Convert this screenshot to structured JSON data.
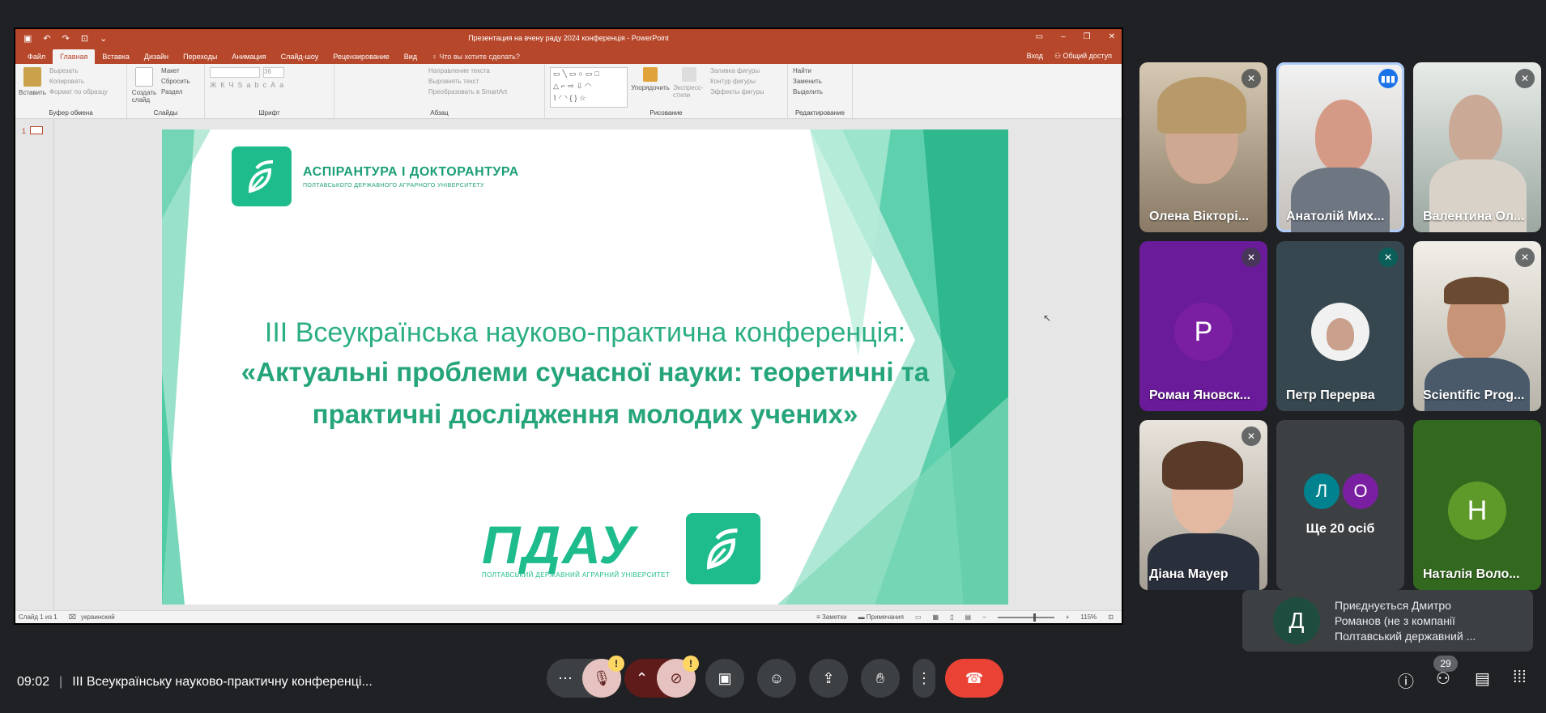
{
  "powerpoint": {
    "window_title": "Презентация на вчену раду 2024 конференція - PowerPoint",
    "tabs": [
      "Файл",
      "Главная",
      "Вставка",
      "Дизайн",
      "Переходы",
      "Анимация",
      "Слайд-шоу",
      "Рецензирование",
      "Вид"
    ],
    "active_tab": "Главная",
    "tell_me": "Что вы хотите сделать?",
    "sign_in": "Вход",
    "share": "Общий доступ",
    "ribbon": {
      "clipboard": {
        "paste": "Вставить",
        "cut": "Вырезать",
        "copy": "Копировать",
        "format_painter": "Формат по образцу",
        "label": "Буфер обмена"
      },
      "slides": {
        "new_slide": "Создать слайд",
        "layout": "Макет",
        "reset": "Сбросить",
        "section": "Раздел",
        "label": "Слайды"
      },
      "font": {
        "label": "Шрифт",
        "size": "36"
      },
      "paragraph": {
        "text_direction": "Направление текста",
        "align_text": "Выровнять текст",
        "smartart": "Преобразовать в SmartArt",
        "label": "Абзац"
      },
      "drawing": {
        "arrange": "Упорядочить",
        "quick_styles": "Экспресс-стили",
        "fill": "Заливка фигуры",
        "outline": "Контур фигуры",
        "effects": "Эффекты фигуры",
        "label": "Рисование"
      },
      "editing": {
        "find": "Найти",
        "replace": "Заменить",
        "select": "Выделить",
        "label": "Редактирование"
      }
    },
    "thumb_number": "1",
    "status": {
      "slide": "Слайд 1 из 1",
      "language": "украинский",
      "notes": "Заметки",
      "comments": "Примечания",
      "zoom": "115%"
    }
  },
  "slide": {
    "top_logo_line1": "АСПІРАНТУРА І ДОКТОРАНТУРА",
    "top_logo_line2": "ПОЛТАВСЬКОГО ДЕРЖАВНОГО АГРАРНОГО УНІВЕРСИТЕТУ",
    "heading_line1": "ІІІ Всеукраїнська науково-практична конференція:",
    "heading_line2": "«Актуальні проблеми сучасної науки: теоретичні та",
    "heading_line3": "практичні дослідження молодих учених»",
    "bottom_logo_word": "ПДАУ",
    "bottom_logo_sub": "ПОЛТАВСЬКИЙ ДЕРЖАВНИЙ АГРАРНИЙ УНІВЕРСИТЕТ",
    "colors": {
      "green": "#1ebc8c",
      "green_dark": "#26a57c",
      "green_light": "#7fd9b8"
    }
  },
  "participants": [
    {
      "name": "Олена Вікторі...",
      "muted": true
    },
    {
      "name": "Анатолій Мих...",
      "muted": false,
      "speaking": true
    },
    {
      "name": "Валентина Ол...",
      "muted": true
    },
    {
      "name": "Роман Яновск...",
      "muted": true,
      "initial": "Р",
      "color": "#7b1fa2"
    },
    {
      "name": "Петр Перерва",
      "muted": true
    },
    {
      "name": "Scientific Prog...",
      "muted": true
    },
    {
      "name": "Діана Мауер",
      "muted": true
    },
    {
      "name": "Наталія Воло...",
      "initial": "Н",
      "color": "#5e9a2a"
    }
  ],
  "more_people": {
    "label": "Ще 20 осіб",
    "initials": [
      "Л",
      "О"
    ]
  },
  "join_toast": {
    "initial": "Д",
    "text": "Приєднується Дмитро Романов (не з компанії Полтавський державний ..."
  },
  "meet": {
    "time": "09:02",
    "meeting_title": "ІІІ Всеукраїнську науково-практичну конференці...",
    "participant_count": "29",
    "end_call_color": "#ea4335"
  }
}
